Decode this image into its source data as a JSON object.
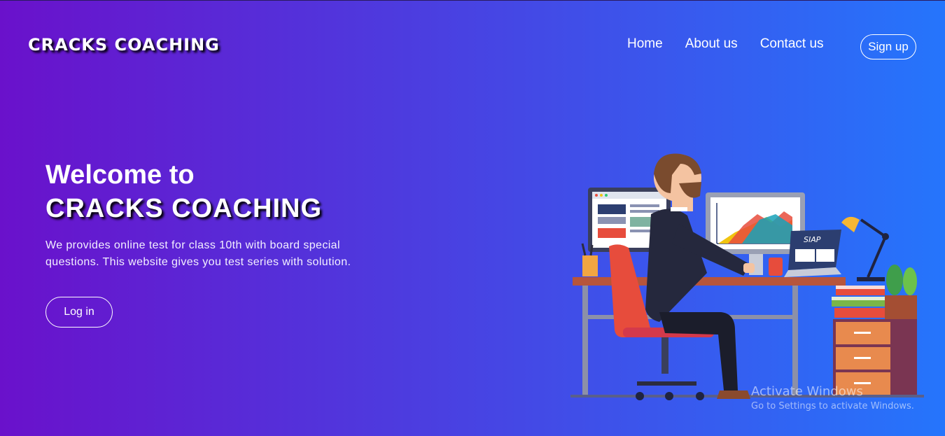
{
  "header": {
    "brand": "CRACKS COACHING",
    "nav": [
      "Home",
      "About us",
      "Contact us"
    ],
    "signup_label": "Sign up"
  },
  "hero": {
    "welcome": "Welcome to",
    "brand": "CRACKS COACHING",
    "description": "We provides online test for class 10th with board special questions. This website gives you test series with solution.",
    "login_label": "Log in"
  },
  "illustration": {
    "laptop_sticker": "SIAP",
    "icons": [
      "person-at-desk",
      "monitor",
      "chart",
      "laptop",
      "desk-lamp",
      "plant",
      "books",
      "chair"
    ]
  },
  "watermark": {
    "title": "Activate Windows",
    "subtitle": "Go to Settings to activate Windows."
  },
  "colors": {
    "gradient_start": "#6a11cb",
    "gradient_end": "#2575fc"
  }
}
